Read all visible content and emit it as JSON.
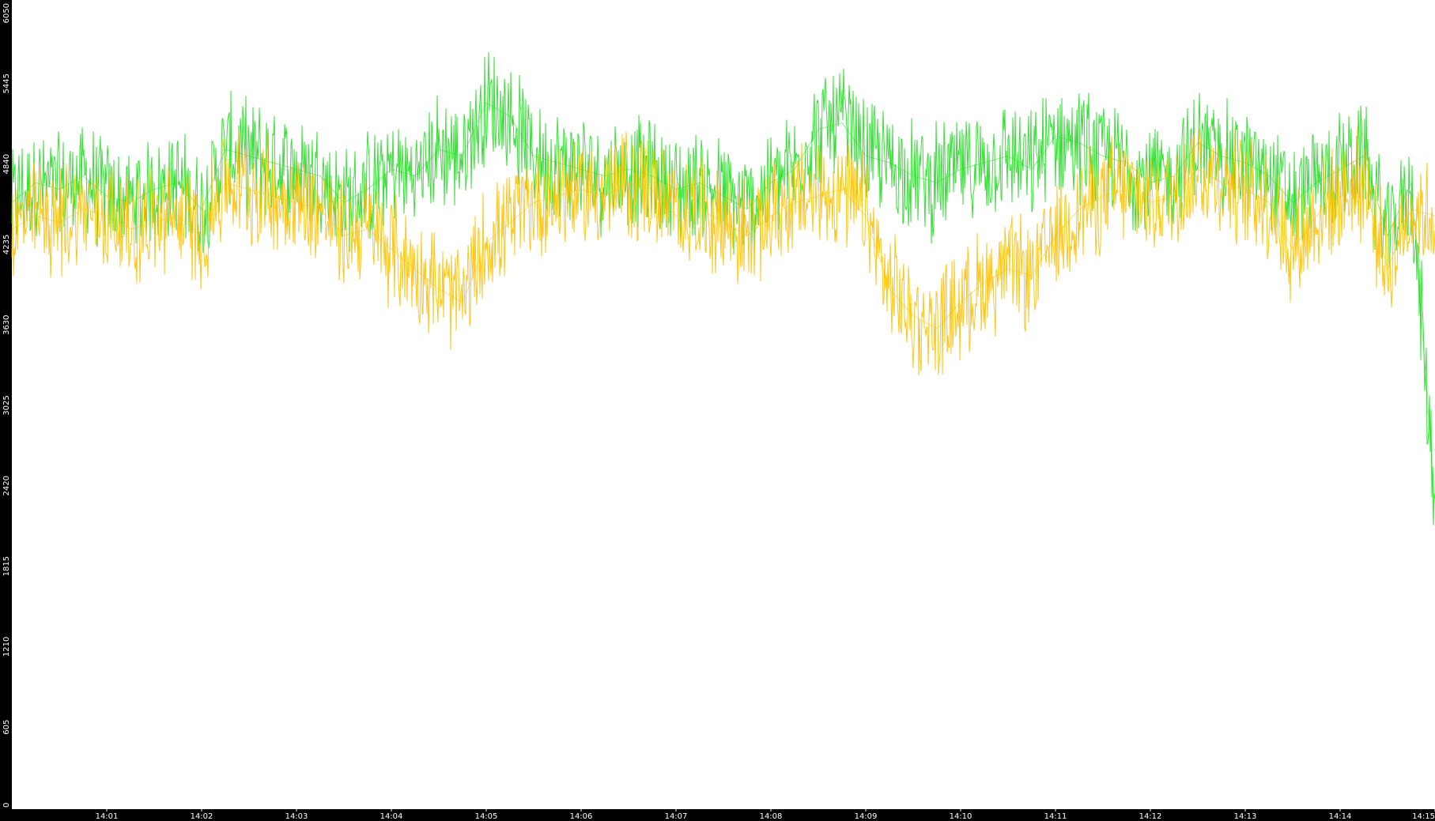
{
  "chart_data": {
    "type": "line",
    "title": "",
    "xlabel": "",
    "ylabel": "",
    "ylim": [
      0,
      6050
    ],
    "y_ticks": [
      "0",
      "605",
      "1210",
      "1815",
      "2420",
      "3025",
      "3630",
      "4235",
      "4840",
      "5445",
      "6050"
    ],
    "x_ticks": [
      "14:01",
      "14:02",
      "14:03",
      "14:04",
      "14:05",
      "14:06",
      "14:07",
      "14:08",
      "14:09",
      "14:10",
      "14:11",
      "14:12",
      "14:13",
      "14:14",
      "14:15"
    ],
    "grid": false,
    "legend": "none",
    "series": [
      {
        "color": "#22dd22",
        "x": [
          "14:00:00",
          "14:00:15",
          "14:00:30",
          "14:00:45",
          "14:01:00",
          "14:01:15",
          "14:01:30",
          "14:01:45",
          "14:02:00",
          "14:02:15",
          "14:02:30",
          "14:02:45",
          "14:03:00",
          "14:03:15",
          "14:03:30",
          "14:03:45",
          "14:04:00",
          "14:04:15",
          "14:04:30",
          "14:04:45",
          "14:05:00",
          "14:05:15",
          "14:05:30",
          "14:05:45",
          "14:06:00",
          "14:06:15",
          "14:06:30",
          "14:06:45",
          "14:07:00",
          "14:07:15",
          "14:07:30",
          "14:07:45",
          "14:08:00",
          "14:08:15",
          "14:08:30",
          "14:08:45",
          "14:09:00",
          "14:09:15",
          "14:09:30",
          "14:09:45",
          "14:10:00",
          "14:10:15",
          "14:10:30",
          "14:10:45",
          "14:11:00",
          "14:11:15",
          "14:11:30",
          "14:11:45",
          "14:12:00",
          "14:12:15",
          "14:12:30",
          "14:12:45",
          "14:13:00",
          "14:13:15",
          "14:13:30",
          "14:13:45",
          "14:14:00",
          "14:14:15",
          "14:14:30",
          "14:14:45",
          "14:15:00"
        ],
        "values": [
          4550,
          4700,
          4650,
          4750,
          4600,
          4550,
          4650,
          4700,
          4500,
          4950,
          4900,
          4850,
          4800,
          4750,
          4550,
          4650,
          4800,
          4750,
          4950,
          4900,
          5300,
          5200,
          4900,
          4850,
          4800,
          4750,
          4800,
          4750,
          4650,
          4700,
          4600,
          4500,
          4700,
          4800,
          5100,
          5150,
          4900,
          4850,
          4750,
          4700,
          4800,
          4850,
          4900,
          4800,
          5050,
          5000,
          4900,
          4850,
          4700,
          4750,
          5000,
          4900,
          4850,
          4750,
          4550,
          4700,
          4800,
          4900,
          4300,
          4700,
          2300
        ]
      },
      {
        "color": "#ffc000",
        "x": [
          "14:00:00",
          "14:00:15",
          "14:00:30",
          "14:00:45",
          "14:01:00",
          "14:01:15",
          "14:01:30",
          "14:01:45",
          "14:02:00",
          "14:02:15",
          "14:02:30",
          "14:02:45",
          "14:03:00",
          "14:03:15",
          "14:03:30",
          "14:03:45",
          "14:04:00",
          "14:04:15",
          "14:04:30",
          "14:04:45",
          "14:05:00",
          "14:05:15",
          "14:05:30",
          "14:05:45",
          "14:06:00",
          "14:06:15",
          "14:06:30",
          "14:06:45",
          "14:07:00",
          "14:07:15",
          "14:07:30",
          "14:07:45",
          "14:08:00",
          "14:08:15",
          "14:08:30",
          "14:08:45",
          "14:09:00",
          "14:09:15",
          "14:09:30",
          "14:09:45",
          "14:10:00",
          "14:10:15",
          "14:10:30",
          "14:10:45",
          "14:11:00",
          "14:11:15",
          "14:11:30",
          "14:11:45",
          "14:12:00",
          "14:12:15",
          "14:12:30",
          "14:12:45",
          "14:13:00",
          "14:13:15",
          "14:13:30",
          "14:13:45",
          "14:14:00",
          "14:14:15",
          "14:14:30",
          "14:14:45",
          "14:15:00"
        ],
        "values": [
          4350,
          4450,
          4400,
          4500,
          4450,
          4350,
          4400,
          4450,
          4300,
          4700,
          4650,
          4600,
          4550,
          4500,
          4300,
          4350,
          4200,
          4050,
          3900,
          3800,
          4250,
          4400,
          4550,
          4600,
          4650,
          4600,
          4700,
          4650,
          4450,
          4500,
          4400,
          4300,
          4450,
          4550,
          4600,
          4650,
          4450,
          3900,
          3700,
          3600,
          3800,
          3950,
          4050,
          4000,
          4300,
          4500,
          4600,
          4650,
          4550,
          4600,
          4800,
          4700,
          4650,
          4550,
          4200,
          4450,
          4600,
          4700,
          4050,
          4500,
          4450
        ]
      }
    ]
  }
}
